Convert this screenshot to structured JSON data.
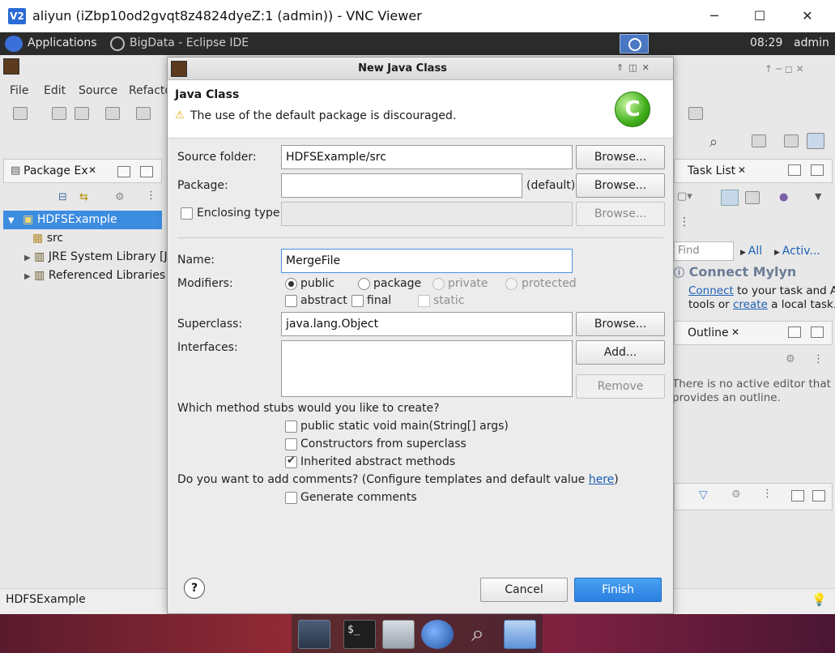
{
  "vnc": {
    "logo": "V2",
    "title": "aliyun (iZbp10od2gvqt8z4824dyeZ:1 (admin)) - VNC Viewer",
    "minimize": "─",
    "maximize": "☐",
    "close": "✕"
  },
  "panel": {
    "applications": "Applications",
    "window": "BigData - Eclipse IDE",
    "time": "08:29",
    "user": "admin"
  },
  "eclipse": {
    "menu": [
      "File",
      "Edit",
      "Source",
      "Refacto"
    ],
    "package_view_title": "Package Ex",
    "tree": [
      {
        "label": "HDFSExample",
        "selected": true
      },
      {
        "label": "src"
      },
      {
        "label": "JRE System Library [Ja"
      },
      {
        "label": "Referenced Libraries"
      }
    ],
    "task_list_title": "Task List",
    "find_placeholder": "Find",
    "all_label": "All",
    "activ_label": "Activ...",
    "connect_mylyn_title": "Connect Mylyn",
    "connect_link": "Connect",
    "mylyn_text1": " to your task and A",
    "mylyn_text2": "tools or ",
    "create_link": "create",
    "mylyn_text3": " a local task.",
    "outline_title": "Outline",
    "outline_text1": "There is no active editor that",
    "outline_text2": "provides an outline.",
    "status": "HDFSExample"
  },
  "dialog": {
    "title": "New Java Class",
    "header_title": "Java Class",
    "warning": "The use of the default package is discouraged.",
    "source_folder_label": "Source folder:",
    "source_folder_value": "HDFSExample/src",
    "package_label": "Package:",
    "package_value": "",
    "package_default": "(default)",
    "enclosing_label": "Enclosing type:",
    "name_label": "Name:",
    "name_value": "MergeFile",
    "modifiers_label": "Modifiers:",
    "modifiers": {
      "public": "public",
      "package": "package",
      "private": "private",
      "protected": "protected",
      "abstract": "abstract",
      "final": "final",
      "static": "static"
    },
    "superclass_label": "Superclass:",
    "superclass_value": "java.lang.Object",
    "interfaces_label": "Interfaces:",
    "browse": "Browse...",
    "add": "Add...",
    "remove": "Remove",
    "stubs_question": "Which method stubs would you like to create?",
    "stub_main": "public static void main(String[] args)",
    "stub_constructors": "Constructors from superclass",
    "stub_inherited": "Inherited abstract methods",
    "comments_question": "Do you want to add comments? (Configure templates and default value ",
    "here_link": "here",
    "comments_question_end": ")",
    "generate_comments": "Generate comments",
    "help": "?",
    "cancel": "Cancel",
    "finish": "Finish"
  }
}
